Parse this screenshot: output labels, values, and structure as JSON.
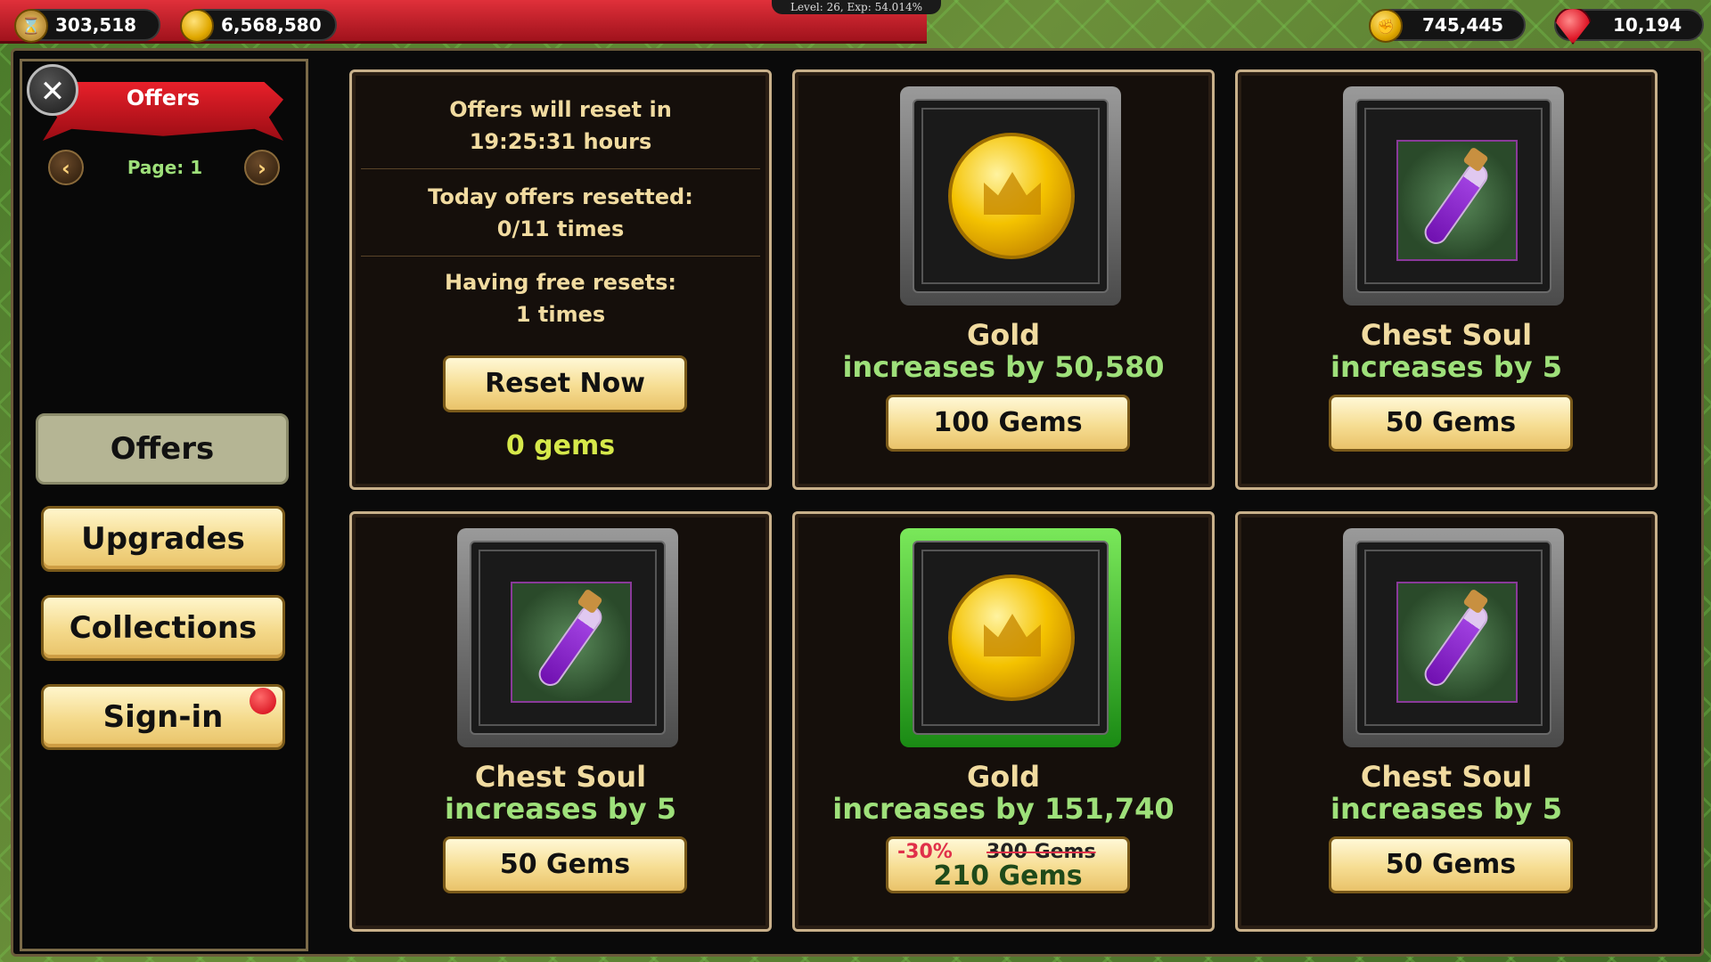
{
  "hud": {
    "food": "303,518",
    "gold": "6,568,580",
    "level_text": "Level: 26, Exp: 54.014%",
    "power": "745,445",
    "gems": "10,194"
  },
  "sidebar": {
    "title": "Offers",
    "page_label": "Page: 1",
    "tabs": [
      {
        "label": "Offers"
      },
      {
        "label": "Upgrades"
      },
      {
        "label": "Collections"
      },
      {
        "label": "Sign-in"
      }
    ]
  },
  "info_card": {
    "reset_line1": "Offers will reset in",
    "reset_time": "19:25:31 hours",
    "resetted_line1": "Today offers resetted:",
    "resetted_value": "0/11 times",
    "free_line1": "Having free resets:",
    "free_value": "1 times",
    "reset_button": "Reset Now",
    "cost": "0 gems"
  },
  "offers": [
    {
      "name": "Gold",
      "increase": "increases by   50,580",
      "price": "100 Gems",
      "icon": "gold-coin-icon"
    },
    {
      "name": "Chest Soul",
      "increase": "increases by   5",
      "price": "50 Gems",
      "icon": "purple-potion-icon"
    },
    {
      "name": "Chest Soul",
      "increase": "increases by   5",
      "price": "50 Gems",
      "icon": "purple-potion-icon"
    },
    {
      "name": "Gold",
      "increase": "increases by   151,740",
      "discount": "-30%",
      "old_price": "300 Gems",
      "price": "210 Gems",
      "icon": "gold-coin-icon",
      "highlight": "green"
    },
    {
      "name": "Chest Soul",
      "increase": "increases by   5",
      "price": "50 Gems",
      "icon": "purple-potion-icon"
    }
  ]
}
